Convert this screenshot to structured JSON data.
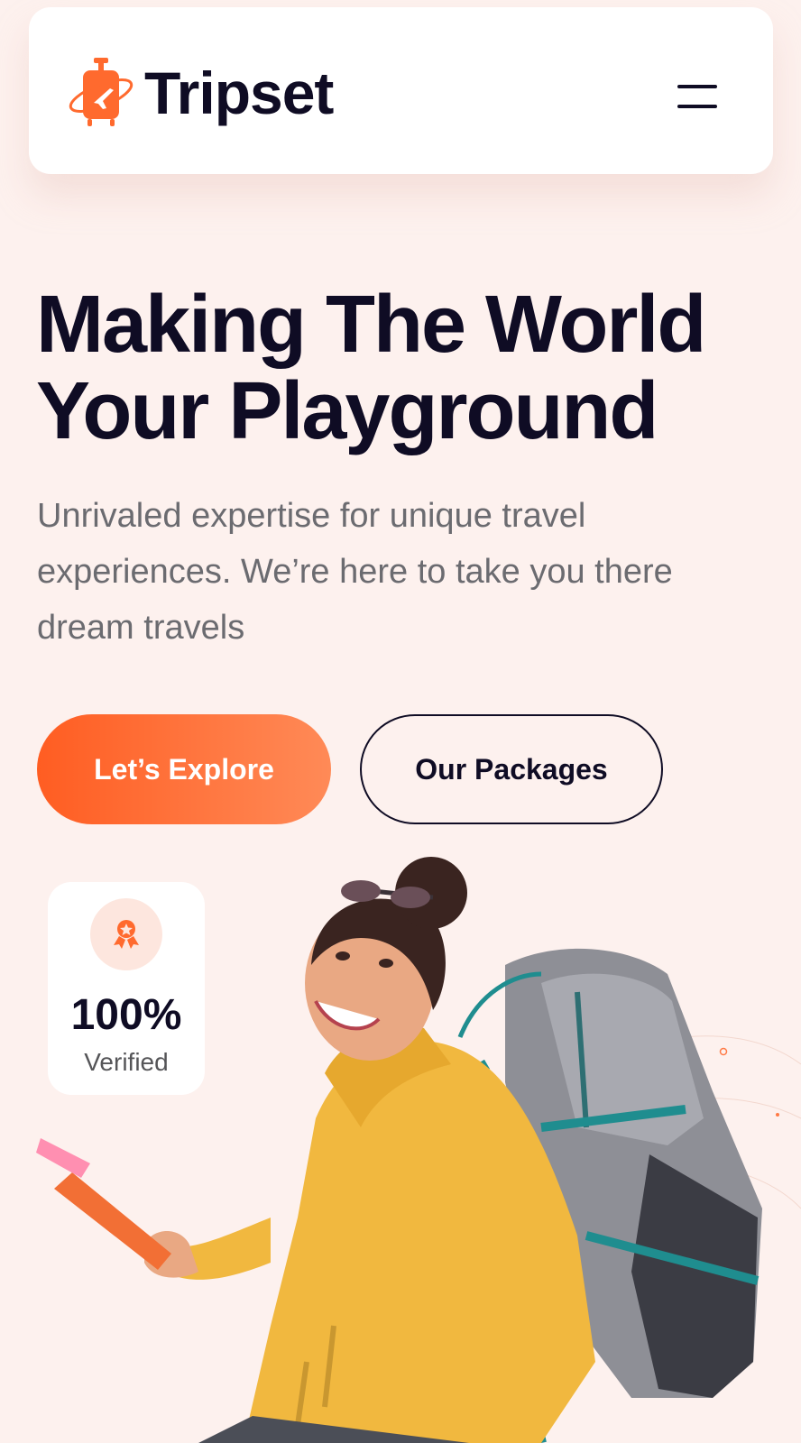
{
  "brand": {
    "name": "Tripset",
    "accent_color": "#ff6a2e",
    "dark_color": "#0f0c24",
    "logo_icon": "suitcase-plane-icon"
  },
  "header": {
    "menu_icon": "hamburger-menu-icon"
  },
  "hero": {
    "headline_line1": "Making The World",
    "headline_line2": "Your Playground",
    "subtext": "Unrivaled expertise for unique travel experiences. We’re here to take you there dream travels",
    "primary_button": "Let’s Explore",
    "secondary_button": "Our Packages"
  },
  "stat_card": {
    "icon": "award-badge-icon",
    "value": "100%",
    "label": "Verified"
  }
}
